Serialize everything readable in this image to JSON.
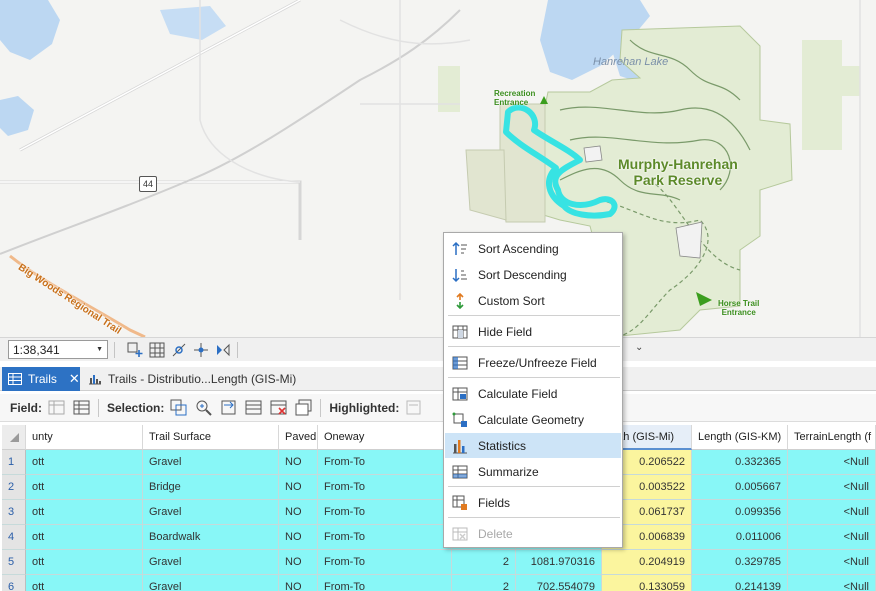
{
  "map": {
    "lake_label": "Hanrehan Lake",
    "park_label_line1": "Murphy-Hanrehan",
    "park_label_line2": "Park Reserve",
    "rec_entrance_line1": "Recreation",
    "rec_entrance_line2": "Entrance",
    "horse_entrance_line1": "Horse Trail",
    "horse_entrance_line2": "Entrance",
    "road_label": "Big Woods Regional Trail",
    "highway_shield": "44"
  },
  "map_status": {
    "scale": "1:38,341"
  },
  "tabs": [
    {
      "label": "Trails",
      "icon": "table-icon"
    },
    {
      "label": "Trails - Distributio...Length (GIS-Mi)",
      "icon": "histogram-icon"
    }
  ],
  "toolbar": {
    "field_label": "Field:",
    "selection_label": "Selection:",
    "highlighted_label": "Highlighted:"
  },
  "table": {
    "columns": [
      "unty",
      "Trail Surface",
      "Paved",
      "Oneway",
      "",
      "",
      "ngth (GIS-Mi)",
      "Length (GIS-KM)",
      "TerrainLength (f"
    ],
    "rows": [
      {
        "id": "1",
        "county": "ott",
        "surface": "Gravel",
        "paved": "NO",
        "oneway": "From-To",
        "c5": "",
        "c6": "",
        "mi": "0.206522",
        "km": "0.332365",
        "terrain": "<Null"
      },
      {
        "id": "2",
        "county": "ott",
        "surface": "Bridge",
        "paved": "NO",
        "oneway": "From-To",
        "c5": "",
        "c6": "",
        "mi": "0.003522",
        "km": "0.005667",
        "terrain": "<Null"
      },
      {
        "id": "3",
        "county": "ott",
        "surface": "Gravel",
        "paved": "NO",
        "oneway": "From-To",
        "c5": "",
        "c6": "",
        "mi": "0.061737",
        "km": "0.099356",
        "terrain": "<Null"
      },
      {
        "id": "4",
        "county": "ott",
        "surface": "Boardwalk",
        "paved": "NO",
        "oneway": "From-To",
        "c5": "",
        "c6": "",
        "mi": "0.006839",
        "km": "0.011006",
        "terrain": "<Null"
      },
      {
        "id": "5",
        "county": "ott",
        "surface": "Gravel",
        "paved": "NO",
        "oneway": "From-To",
        "c5": "2",
        "c6": "1081.970316",
        "mi": "0.204919",
        "km": "0.329785",
        "terrain": "<Null"
      },
      {
        "id": "6",
        "county": "ott",
        "surface": "Gravel",
        "paved": "NO",
        "oneway": "From-To",
        "c5": "2",
        "c6": "702.554079",
        "mi": "0.133059",
        "km": "0.214139",
        "terrain": "<Null"
      }
    ]
  },
  "context_menu": {
    "items": [
      {
        "label": "Sort Ascending",
        "icon": "sort-ascending-icon"
      },
      {
        "label": "Sort Descending",
        "icon": "sort-descending-icon"
      },
      {
        "label": "Custom Sort",
        "icon": "custom-sort-icon"
      },
      {
        "label": "Hide Field",
        "icon": "hide-field-icon"
      },
      {
        "label": "Freeze/Unfreeze Field",
        "icon": "freeze-field-icon"
      },
      {
        "label": "Calculate Field",
        "icon": "calculate-field-icon"
      },
      {
        "label": "Calculate Geometry",
        "icon": "calculate-geometry-icon"
      },
      {
        "label": "Statistics",
        "icon": "statistics-icon"
      },
      {
        "label": "Summarize",
        "icon": "summarize-icon"
      },
      {
        "label": "Fields",
        "icon": "fields-icon"
      },
      {
        "label": "Delete",
        "icon": "delete-icon"
      }
    ]
  }
}
